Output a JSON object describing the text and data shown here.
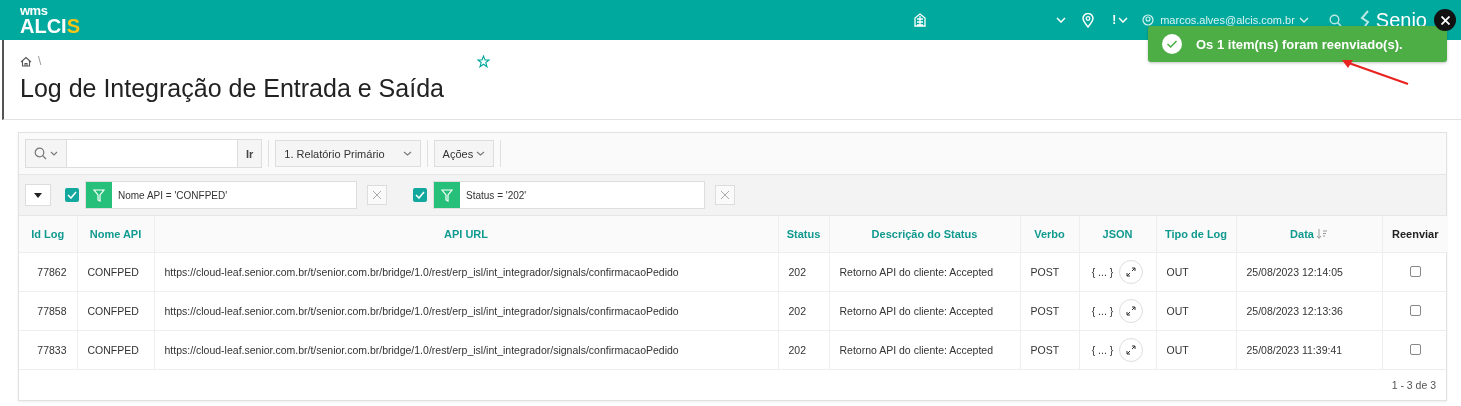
{
  "header": {
    "logo_top": "wms",
    "logo_main": "ALCI",
    "logo_accent": "S",
    "user_email": "marcos.alves@alcis.com.br",
    "brand": "Senio",
    "alert_mark": "!"
  },
  "toast": {
    "message": "Os 1 item(ns) foram reenviado(s)."
  },
  "breadcrumb": {
    "separator": "\\"
  },
  "title": "Log de Integração de Entrada e Saída",
  "toolbar": {
    "go_button": "Ir",
    "report": "1. Relatório Primário",
    "actions": "Ações"
  },
  "filters": [
    {
      "text": "Nome API = 'CONFPED'",
      "enabled": true
    },
    {
      "text": "Status = '202'",
      "enabled": true
    }
  ],
  "table": {
    "columns": [
      {
        "label": "Id Log",
        "kind": "data"
      },
      {
        "label": "Nome API",
        "kind": "data"
      },
      {
        "label": "API URL",
        "kind": "data"
      },
      {
        "label": "Status",
        "kind": "data"
      },
      {
        "label": "Descrição do Status",
        "kind": "data"
      },
      {
        "label": "Verbo",
        "kind": "data"
      },
      {
        "label": "JSON",
        "kind": "data"
      },
      {
        "label": "Tipo de Log",
        "kind": "data"
      },
      {
        "label": "Data",
        "kind": "sorted"
      },
      {
        "label": "Reenviar",
        "kind": "action"
      }
    ],
    "rows": [
      {
        "id_log": "77862",
        "nome_api": "CONFPED",
        "api_url": "https://cloud-leaf.senior.com.br/t/senior.com.br/bridge/1.0/rest/erp_isl/int_integrador/signals/confirmacaoPedido",
        "status": "202",
        "descricao": "Retorno API do cliente: Accepted",
        "verbo": "POST",
        "json": "{ ... }",
        "tipo": "OUT",
        "data": "25/08/2023 12:14:05",
        "reenviar": false
      },
      {
        "id_log": "77858",
        "nome_api": "CONFPED",
        "api_url": "https://cloud-leaf.senior.com.br/t/senior.com.br/bridge/1.0/rest/erp_isl/int_integrador/signals/confirmacaoPedido",
        "status": "202",
        "descricao": "Retorno API do cliente: Accepted",
        "verbo": "POST",
        "json": "{ ... }",
        "tipo": "OUT",
        "data": "25/08/2023 12:13:36",
        "reenviar": false
      },
      {
        "id_log": "77833",
        "nome_api": "CONFPED",
        "api_url": "https://cloud-leaf.senior.com.br/t/senior.com.br/bridge/1.0/rest/erp_isl/int_integrador/signals/confirmacaoPedido",
        "status": "202",
        "descricao": "Retorno API do cliente: Accepted",
        "verbo": "POST",
        "json": "{ ... }",
        "tipo": "OUT",
        "data": "25/08/2023 11:39:41",
        "reenviar": false
      }
    ],
    "pagination": "1 - 3 de 3"
  }
}
